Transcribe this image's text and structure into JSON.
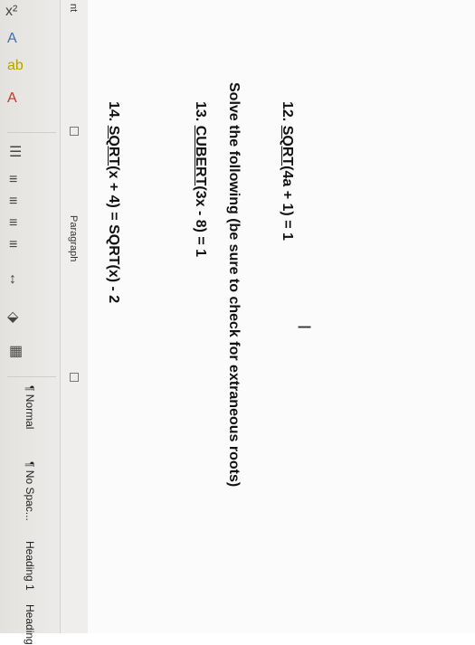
{
  "ribbon": {
    "left_edge_text": "nt",
    "paragraph_group_label": "Paragraph",
    "styles": [
      "¶ Normal",
      "¶ No Spac...",
      "Heading 1",
      "Heading"
    ]
  },
  "document": {
    "instruction": "Solve the following (be sure to check for extraneous roots)",
    "problems": [
      {
        "number": "12.",
        "fn": "SQRT",
        "rest": "(4a + 1) = 1"
      },
      {
        "number": "13.",
        "fn": "CUBERT",
        "rest": "(3x - 8) = 1"
      },
      {
        "number": "14.",
        "fn": "SQRT",
        "rest": "(x + 4) = SQRT(x) - 2"
      }
    ]
  },
  "icons": [
    "superscript-icon",
    "text-effects-icon",
    "highlight-icon",
    "font-color-icon",
    "bullets-icon",
    "align-left-icon",
    "center-icon",
    "align-right-icon",
    "justify-icon",
    "line-spacing-icon",
    "shading-icon",
    "borders-icon",
    "dialog-launcher-icon",
    "text-cursor-icon"
  ],
  "colors": {
    "ribbon": "#e8e6e3",
    "page": "#fbfbfb",
    "text": "#111111"
  }
}
